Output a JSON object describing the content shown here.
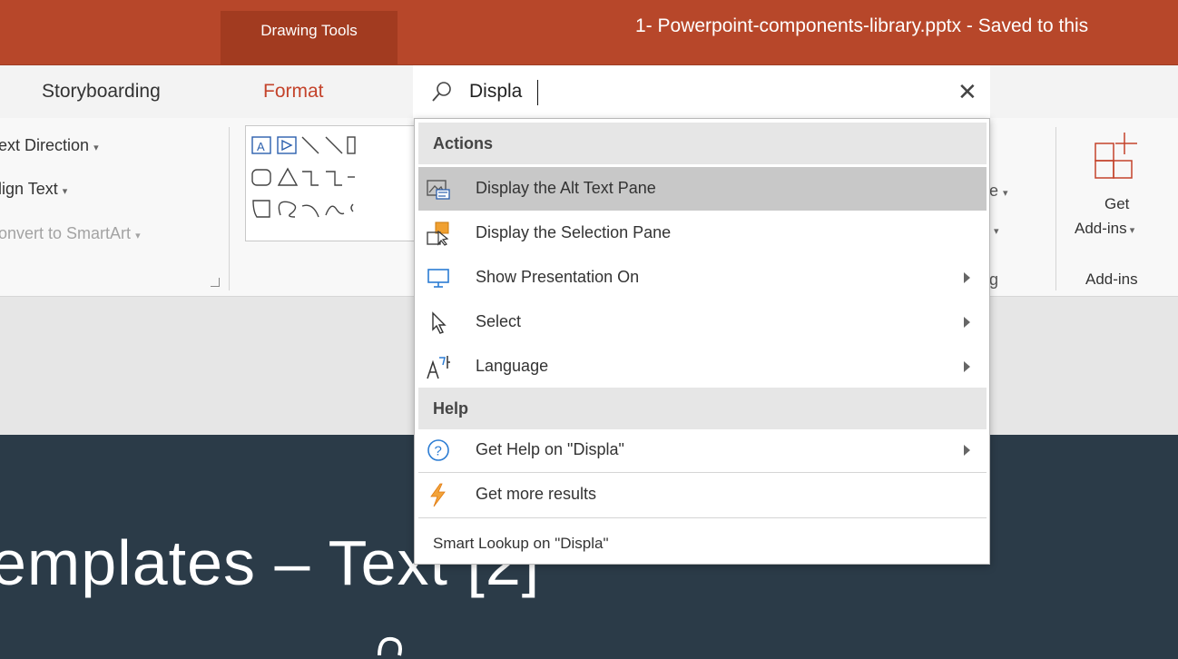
{
  "titlebar": {
    "contextual_tab": "Drawing Tools",
    "document_title": "1- Powerpoint-components-library.pptx  -  Saved to this"
  },
  "tabs": {
    "storyboarding": "Storyboarding",
    "format": "Format"
  },
  "ribbon": {
    "text_direction": "ext Direction",
    "align_text": "lign Text",
    "convert_smartart": "onvert to SmartArt",
    "partial_right_1": "e",
    "partial_right_2": "g",
    "get_addins_line1": "Get",
    "get_addins_line2": "Add-ins",
    "addins_group": "Add-ins"
  },
  "search": {
    "value": "Displa",
    "placeholder": "Displa"
  },
  "dropdown": {
    "actions_header": "Actions",
    "items": [
      {
        "label": "Display the Alt Text Pane",
        "icon": "alt-text-icon"
      },
      {
        "label": "Display the Selection Pane",
        "icon": "selection-pane-icon"
      },
      {
        "label": "Show Presentation On",
        "icon": "monitor-icon"
      },
      {
        "label": "Select",
        "icon": "cursor-icon"
      },
      {
        "label": "Language",
        "icon": "language-icon"
      }
    ],
    "help_header": "Help",
    "help_items": [
      {
        "label": "Get Help on \"Displa\"",
        "icon": "help-icon"
      },
      {
        "label": "Get more results",
        "icon": "lightning-icon"
      }
    ],
    "smart_lookup": "Smart Lookup on \"Displa\""
  },
  "slide": {
    "title": "emplates – Text [2]"
  },
  "colors": {
    "accent": "#b7472a",
    "slide_bg": "#2b3b48",
    "highlight": "#c8c8c8"
  }
}
